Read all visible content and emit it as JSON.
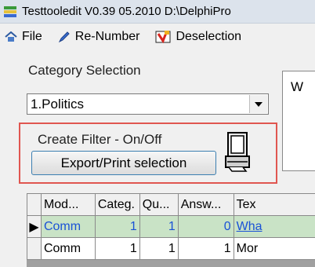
{
  "window": {
    "title": "Testtooledit V0.39 05.2010 D:\\DelphiPro"
  },
  "menu": {
    "file_label": "File",
    "renumber_label": "Re-Number",
    "deselection_label": "Deselection"
  },
  "category": {
    "label": "Category Selection",
    "selected": "1.Politics"
  },
  "memo": {
    "text": "W"
  },
  "filter": {
    "label": "Create Filter - On/Off",
    "export_label": "Export/Print selection"
  },
  "grid": {
    "columns": [
      "Mod...",
      "Categ.",
      "Qu...",
      "Answ...",
      "Tex"
    ],
    "rows": [
      {
        "mod": "Comm",
        "categ": "1",
        "qu": "1",
        "answ": "0",
        "text": "Wha"
      },
      {
        "mod": "Comm",
        "categ": "1",
        "qu": "1",
        "answ": "1",
        "text": "Mor"
      }
    ],
    "active_indicator": "▶"
  },
  "colors": {
    "selected_row_bg": "#c9e3c6",
    "selected_row_text": "#1a52d6",
    "highlight_border": "#e05650"
  }
}
